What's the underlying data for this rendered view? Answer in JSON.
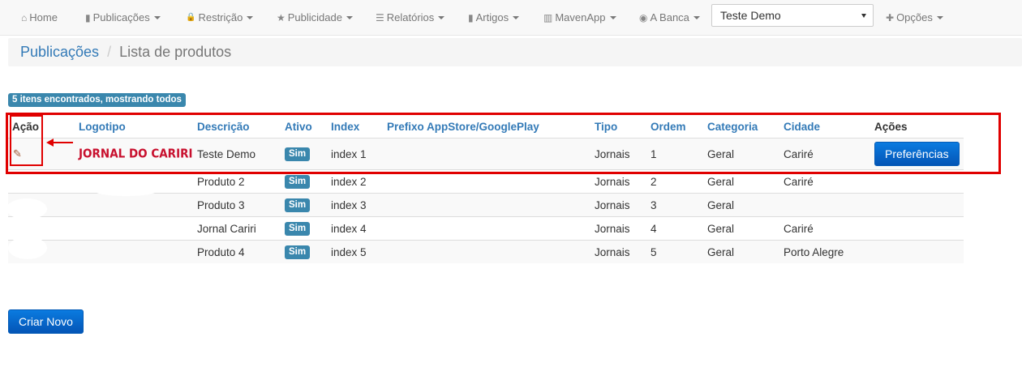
{
  "navbar": {
    "items": [
      {
        "label": "Home",
        "icon": "home-icon",
        "glyph": "⌂",
        "dropdown": false
      },
      {
        "label": "Publicações",
        "icon": "file-icon",
        "glyph": "▮",
        "dropdown": true
      },
      {
        "label": "Restrição",
        "icon": "lock-icon",
        "glyph": "🔒",
        "dropdown": true
      },
      {
        "label": "Publicidade",
        "icon": "star-icon",
        "glyph": "★",
        "dropdown": true
      },
      {
        "label": "Relatórios",
        "icon": "list-icon",
        "glyph": "☰",
        "dropdown": true
      },
      {
        "label": "Artigos",
        "icon": "bookmark-icon",
        "glyph": "▮",
        "dropdown": true
      },
      {
        "label": "MavenApp",
        "icon": "barcode-icon",
        "glyph": "▥",
        "dropdown": true
      },
      {
        "label": "A Banca",
        "icon": "globe-icon",
        "glyph": "◉",
        "dropdown": true
      }
    ],
    "select_value": "Teste Demo",
    "options": {
      "label": "Opções",
      "icon": "plus-icon",
      "glyph": "✚"
    }
  },
  "breadcrumb": {
    "link": "Publicações",
    "separator": "/",
    "active": "Lista de produtos"
  },
  "count_badge": "5 itens encontrados, mostrando todos",
  "table": {
    "headers": {
      "acao": "Ação",
      "logotipo": "Logotipo",
      "descricao": "Descrição",
      "ativo": "Ativo",
      "index": "Index",
      "prefixo": "Prefixo AppStore/GooglePlay",
      "tipo": "Tipo",
      "ordem": "Ordem",
      "categoria": "Categoria",
      "cidade": "Cidade",
      "acoes": "Ações"
    },
    "rows": [
      {
        "logo": "JORNAL DO CARIRI",
        "descricao": "Teste Demo",
        "ativo": "Sim",
        "index": "index 1",
        "tipo": "Jornais",
        "ordem": "1",
        "categoria": "Geral",
        "cidade": "Cariré",
        "action": "Preferências"
      },
      {
        "descricao": "Produto 2",
        "ativo": "Sim",
        "index": "index 2",
        "tipo": "Jornais",
        "ordem": "2",
        "categoria": "Geral",
        "cidade": "Cariré"
      },
      {
        "descricao": "Produto 3",
        "ativo": "Sim",
        "index": "index 3",
        "tipo": "Jornais",
        "ordem": "3",
        "categoria": "Geral",
        "cidade": ""
      },
      {
        "descricao": "Jornal Cariri",
        "ativo": "Sim",
        "index": "index 4",
        "tipo": "Jornais",
        "ordem": "4",
        "categoria": "Geral",
        "cidade": "Cariré"
      },
      {
        "descricao": "Produto 4",
        "ativo": "Sim",
        "index": "index 5",
        "tipo": "Jornais",
        "ordem": "5",
        "categoria": "Geral",
        "cidade": "Porto Alegre"
      }
    ]
  },
  "create_button": "Criar Novo",
  "colors": {
    "link": "#337ab7",
    "badge": "#3a87ad",
    "annotation": "#e00000",
    "button": "#0561c4"
  }
}
